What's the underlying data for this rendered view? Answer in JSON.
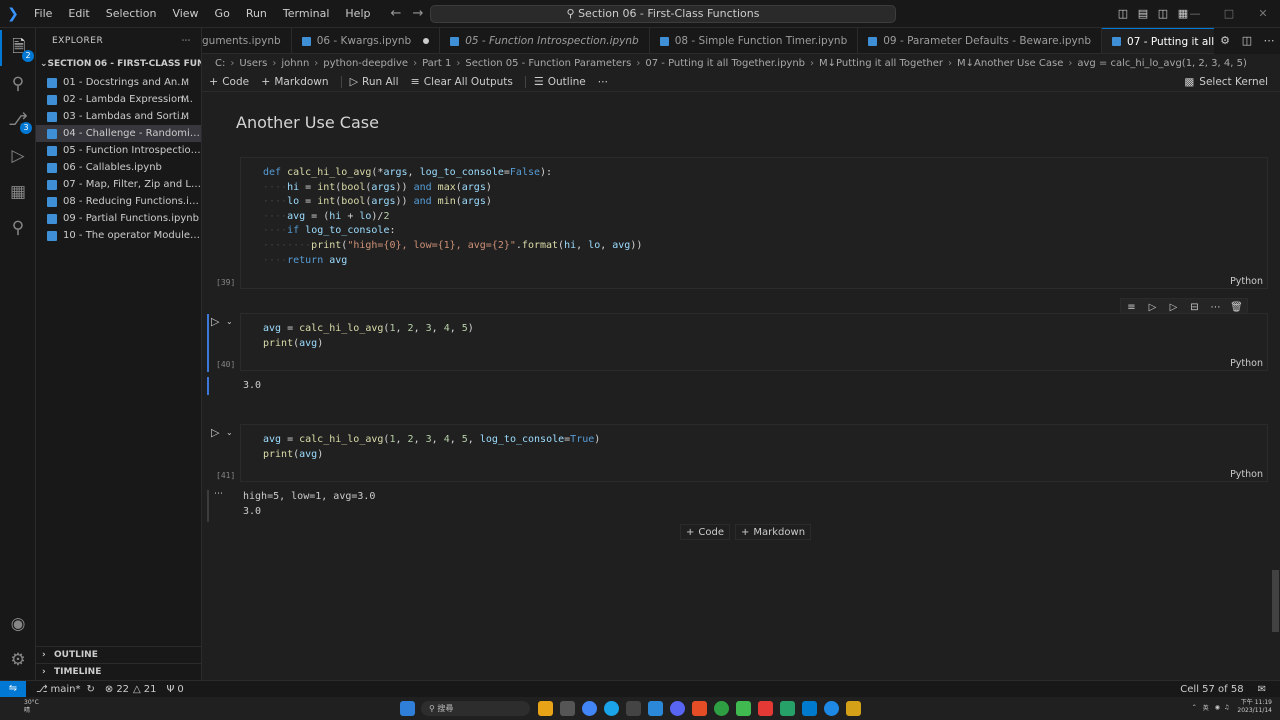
{
  "titlebar": {
    "menu": [
      "File",
      "Edit",
      "Selection",
      "View",
      "Go",
      "Run",
      "Terminal",
      "Help"
    ],
    "command_center": "Section 06 - First-Class Functions"
  },
  "activity": {
    "explorer_badge": "2",
    "scm_badge": "3"
  },
  "sidebar": {
    "title": "EXPLORER",
    "section": "SECTION 06 - FIRST-CLASS FUNCTI...",
    "files": [
      {
        "name": "01 - Docstrings and An...",
        "status": "M"
      },
      {
        "name": "02 - Lambda Expression...",
        "status": "M"
      },
      {
        "name": "03 - Lambdas and Sorti...",
        "status": "M"
      },
      {
        "name": "04 - Challenge - Randomizin...",
        "status": ""
      },
      {
        "name": "05 - Function Introspection.i...",
        "status": ""
      },
      {
        "name": "06 - Callables.ipynb",
        "status": ""
      },
      {
        "name": "07 - Map, Filter, Zip and List ...",
        "status": ""
      },
      {
        "name": "08 - Reducing Functions.ipynb",
        "status": ""
      },
      {
        "name": "09 - Partial Functions.ipynb",
        "status": ""
      },
      {
        "name": "10 - The operator Module.ipy...",
        "status": ""
      }
    ],
    "outline": "OUTLINE",
    "timeline": "TIMELINE"
  },
  "tabs": [
    {
      "label": "guments.ipynb"
    },
    {
      "label": "06 - Kwargs.ipynb"
    },
    {
      "label": "05 - Function Introspection.ipynb"
    },
    {
      "label": "08 - Simple Function Timer.ipynb"
    },
    {
      "label": "09 - Parameter Defaults - Beware.ipynb"
    },
    {
      "label": "07 - Putting it all Together.ipynb"
    }
  ],
  "breadcrumb": [
    "C:",
    "Users",
    "johnn",
    "python-deepdive",
    "Part 1",
    "Section 05 - Function Parameters",
    "07 - Putting it all Together.ipynb",
    "M↓Putting it all Together",
    "M↓Another Use Case",
    "avg = calc_hi_lo_avg(1, 2, 3, 4, 5)"
  ],
  "toolbar": {
    "code": "Code",
    "markdown": "Markdown",
    "run_all": "Run All",
    "clear_outputs": "Clear All Outputs",
    "outline": "Outline",
    "select_kernel": "Select Kernel"
  },
  "notebook": {
    "heading": "Another Use Case",
    "cells": [
      {
        "exec": "[39]",
        "lang": "Python",
        "lines": [
          "def calc_hi_lo_avg(*args, log_to_console=False):",
          "    hi = int(bool(args)) and max(args)",
          "    lo = int(bool(args)) and min(args)",
          "    avg = (hi + lo)/2",
          "    if log_to_console:",
          "        print(\"high={0}, low={1}, avg={2}\".format(hi, lo, avg))",
          "    return avg"
        ],
        "output": []
      },
      {
        "exec": "[40]",
        "lang": "Python",
        "lines": [
          "avg = calc_hi_lo_avg(1, 2, 3, 4, 5)",
          "print(avg)"
        ],
        "output": [
          "3.0"
        ]
      },
      {
        "exec": "[41]",
        "lang": "Python",
        "lines": [
          "avg = calc_hi_lo_avg(1, 2, 3, 4, 5, log_to_console=True)",
          "print(avg)"
        ],
        "output": [
          "high=5, low=1, avg=3.0",
          "3.0"
        ]
      }
    ],
    "add_code": "Code",
    "add_markdown": "Markdown"
  },
  "statusbar": {
    "branch": "main*",
    "errors": "22",
    "warnings": "21",
    "ports": "0",
    "cell_position": "Cell 57 of 58"
  },
  "taskbar": {
    "temperature": "30°C",
    "weather": "晴",
    "search": "搜尋",
    "lang": "英",
    "time": "下午 11:19",
    "date": "2023/11/14"
  },
  "colors": {
    "accent": "#0078d4",
    "keyword": "#569cd6",
    "function": "#dcdcaa",
    "string": "#ce9178",
    "number": "#b5cea8",
    "variable": "#9cdcfe"
  }
}
